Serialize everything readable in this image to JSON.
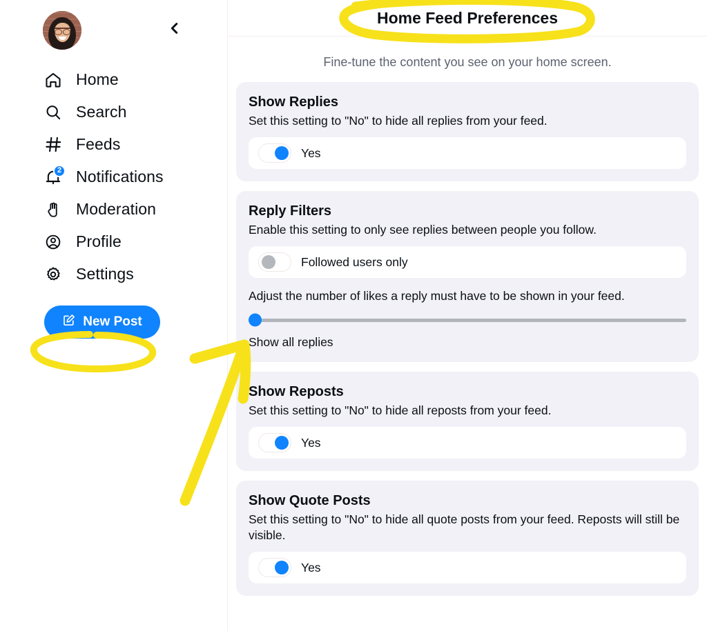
{
  "sidebar": {
    "avatar_alt": "user-avatar",
    "collapse_icon": "chevron-left-icon",
    "items": [
      {
        "icon": "home-icon",
        "label": "Home"
      },
      {
        "icon": "search-icon",
        "label": "Search"
      },
      {
        "icon": "hashtag-icon",
        "label": "Feeds"
      },
      {
        "icon": "bell-icon",
        "label": "Notifications",
        "badge": "2"
      },
      {
        "icon": "hand-icon",
        "label": "Moderation"
      },
      {
        "icon": "user-circle-icon",
        "label": "Profile"
      },
      {
        "icon": "gear-icon",
        "label": "Settings"
      }
    ],
    "new_post": {
      "label": "New Post",
      "icon": "compose-icon"
    }
  },
  "main": {
    "title": "Home Feed Preferences",
    "subtitle": "Fine-tune the content you see on your home screen.",
    "cards": [
      {
        "title": "Show Replies",
        "desc": "Set this setting to \"No\" to hide all replies from your feed.",
        "toggle": {
          "label": "Yes",
          "state": "on"
        }
      },
      {
        "title": "Reply Filters",
        "desc": "Enable this setting to only see replies between people you follow.",
        "toggle": {
          "label": "Followed users only",
          "state": "off"
        },
        "slider": {
          "desc": "Adjust the number of likes a reply must have to be shown in your feed.",
          "value": "0",
          "caption": "Show all replies"
        }
      },
      {
        "title": "Show Reposts",
        "desc": "Set this setting to \"No\" to hide all reposts from your feed.",
        "toggle": {
          "label": "Yes",
          "state": "on"
        }
      },
      {
        "title": "Show Quote Posts",
        "desc": "Set this setting to \"No\" to hide all quote posts from your feed. Reposts will still be visible.",
        "toggle": {
          "label": "Yes",
          "state": "on"
        }
      }
    ]
  },
  "annotations": {
    "color": "#f7e11a",
    "title_ellipse": "highlight-ellipse-around-title",
    "settings_ellipse": "highlight-ellipse-around-settings",
    "arrow": "highlight-arrow-pointing-to-reply-filters"
  },
  "colors": {
    "accent": "#1083fe",
    "card_bg": "#f1f1f7",
    "text": "#0b0f14",
    "muted": "#5c6270",
    "highlight": "#f7e11a"
  }
}
